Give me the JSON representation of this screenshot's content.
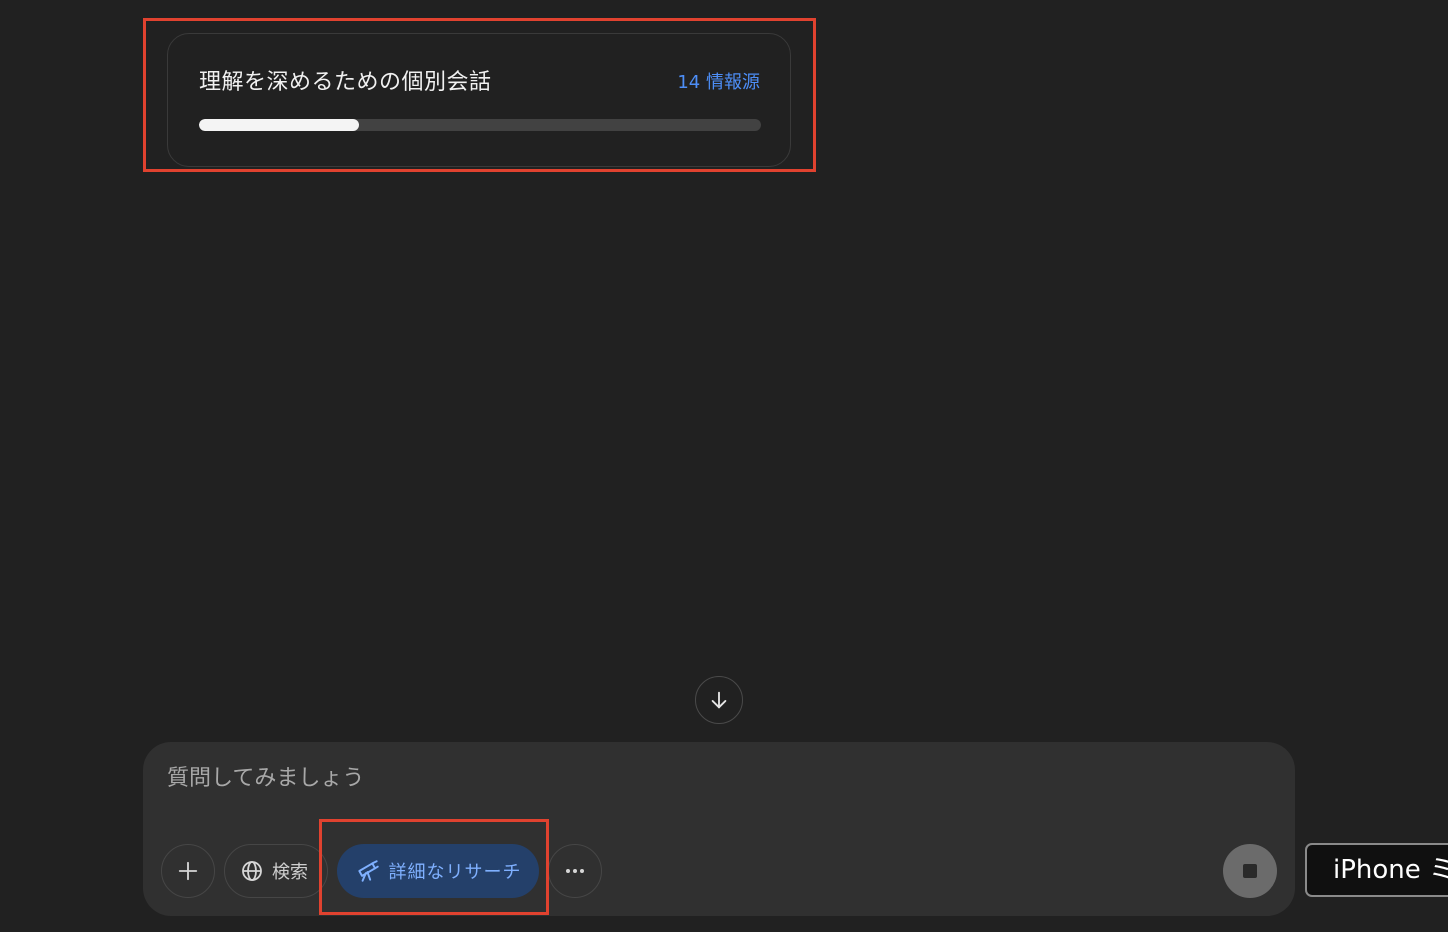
{
  "research_card": {
    "title": "理解を深めるための個別会話",
    "sources_label": "14 情報源",
    "progress_fraction": 0.285
  },
  "composer": {
    "placeholder": "質問してみましょう",
    "tools": {
      "add_icon": "plus-icon",
      "search_label": "検索",
      "search_icon": "globe-icon",
      "research_label": "詳細なリサーチ",
      "research_icon": "telescope-icon",
      "more_icon": "ellipsis-icon"
    },
    "stop_icon": "stop-icon"
  },
  "scroll_down_icon": "arrow-down-icon",
  "side_tooltip": {
    "label": "iPhone ミ"
  },
  "colors": {
    "background": "#212121",
    "composer": "#303030",
    "accent_blue": "#4d8ef7",
    "research_button_bg": "#24406a",
    "highlight_red": "#e0422f"
  }
}
